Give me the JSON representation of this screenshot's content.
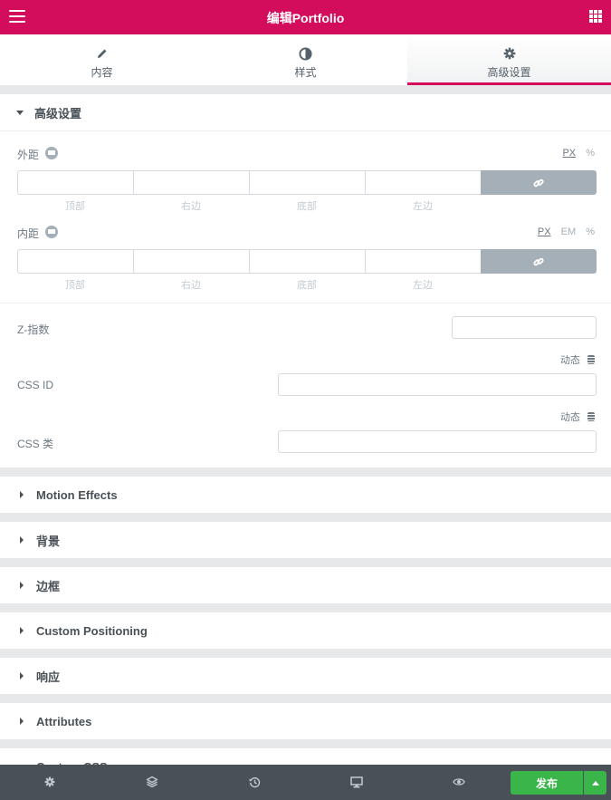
{
  "header": {
    "title": "编辑Portfolio",
    "menu_icon": "hamburger-icon",
    "grid_icon": "apps-grid-icon"
  },
  "tabs": [
    {
      "label": "内容",
      "icon": "pencil-icon"
    },
    {
      "label": "样式",
      "icon": "half-circle-icon"
    },
    {
      "label": "高级设置",
      "icon": "gear-icon",
      "active": true
    }
  ],
  "advanced": {
    "title": "高级设置",
    "margin": {
      "label": "外距",
      "units": [
        "PX",
        "%"
      ],
      "selected_unit": "PX",
      "sides": [
        "顶部",
        "右边",
        "底部",
        "左边"
      ],
      "values": [
        "",
        "",
        "",
        ""
      ]
    },
    "padding": {
      "label": "内距",
      "units": [
        "PX",
        "EM",
        "%"
      ],
      "selected_unit": "PX",
      "sides": [
        "顶部",
        "右边",
        "底部",
        "左边"
      ],
      "values": [
        "",
        "",
        "",
        ""
      ]
    },
    "z_index": {
      "label": "Z-指数",
      "value": ""
    },
    "dynamic_label": "动态",
    "css_id": {
      "label": "CSS ID",
      "value": ""
    },
    "css_class": {
      "label": "CSS 类",
      "value": ""
    }
  },
  "sections": [
    "Motion Effects",
    "背景",
    "边框",
    "Custom Positioning",
    "响应",
    "Attributes",
    "Custom CSS"
  ],
  "footer": {
    "icons": [
      "settings-icon",
      "layers-icon",
      "history-icon",
      "responsive-icon",
      "preview-eye-icon"
    ],
    "publish_label": "发布"
  },
  "colors": {
    "accent": "#d30c5c",
    "publish": "#39b54a",
    "footer": "#495157"
  }
}
